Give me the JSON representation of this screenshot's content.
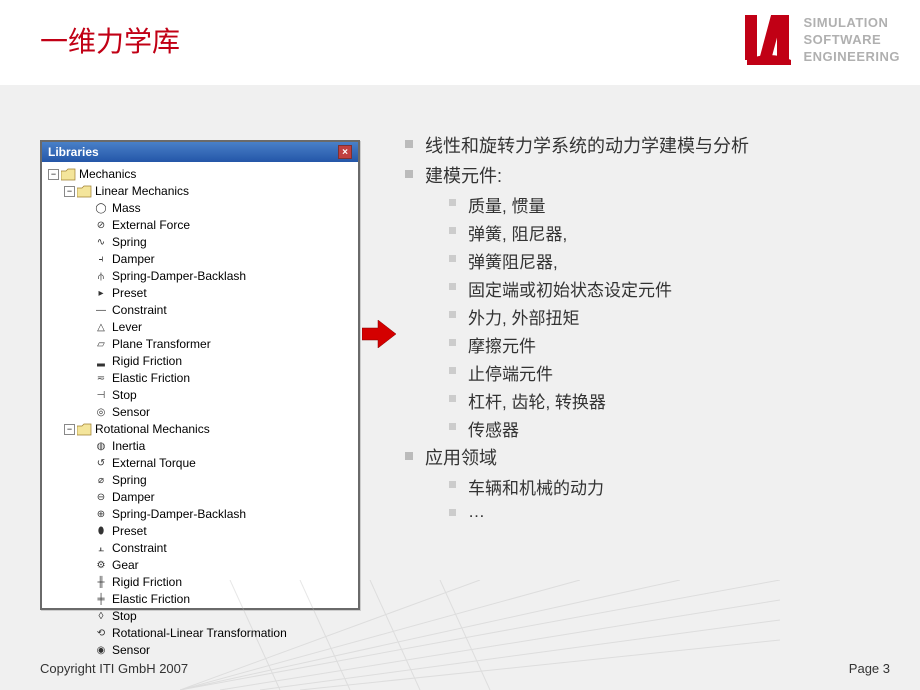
{
  "header": {
    "title": "一维力学库",
    "tagline": [
      "SIMULATION",
      "SOFTWARE",
      "ENGINEERING"
    ]
  },
  "tree": {
    "title": "Libraries",
    "root": {
      "label": "Mechanics",
      "type": "folder",
      "open": true,
      "children": [
        {
          "label": "Linear Mechanics",
          "type": "folder",
          "open": true,
          "children": [
            {
              "label": "Mass",
              "icon": "mass"
            },
            {
              "label": "External Force",
              "icon": "ext-force"
            },
            {
              "label": "Spring",
              "icon": "spring"
            },
            {
              "label": "Damper",
              "icon": "damper"
            },
            {
              "label": "Spring-Damper-Backlash",
              "icon": "sdb"
            },
            {
              "label": "Preset",
              "icon": "preset"
            },
            {
              "label": "Constraint",
              "icon": "constraint"
            },
            {
              "label": "Lever",
              "icon": "lever"
            },
            {
              "label": "Plane Transformer",
              "icon": "plane-trans"
            },
            {
              "label": "Rigid Friction",
              "icon": "rigid-friction"
            },
            {
              "label": "Elastic Friction",
              "icon": "elastic-friction"
            },
            {
              "label": "Stop",
              "icon": "stop"
            },
            {
              "label": "Sensor",
              "icon": "sensor"
            }
          ]
        },
        {
          "label": "Rotational Mechanics",
          "type": "folder",
          "open": true,
          "children": [
            {
              "label": "Inertia",
              "icon": "inertia"
            },
            {
              "label": "External Torque",
              "icon": "ext-torque"
            },
            {
              "label": "Spring",
              "icon": "rot-spring"
            },
            {
              "label": "Damper",
              "icon": "rot-damper"
            },
            {
              "label": "Spring-Damper-Backlash",
              "icon": "rot-sdb"
            },
            {
              "label": "Preset",
              "icon": "rot-preset"
            },
            {
              "label": "Constraint",
              "icon": "rot-constraint"
            },
            {
              "label": "Gear",
              "icon": "gear"
            },
            {
              "label": "Rigid Friction",
              "icon": "rot-rigid-friction"
            },
            {
              "label": "Elastic Friction",
              "icon": "rot-elastic-friction"
            },
            {
              "label": "Stop",
              "icon": "rot-stop"
            },
            {
              "label": "Rotational-Linear Transformation",
              "icon": "rot-lin"
            },
            {
              "label": "Sensor",
              "icon": "rot-sensor"
            }
          ]
        }
      ]
    }
  },
  "content": {
    "level1": [
      {
        "text": "线性和旋转力学系统的动力学建模与分析"
      },
      {
        "text": "建模元件:",
        "children": [
          "质量, 惯量",
          "弹簧, 阻尼器,",
          "弹簧阻尼器,",
          "固定端或初始状态设定元件",
          "外力, 外部扭矩",
          "摩擦元件",
          "止停端元件",
          "杠杆, 齿轮, 转换器",
          "传感器"
        ]
      },
      {
        "text": "应用领域",
        "children": [
          "车辆和机械的动力",
          "…"
        ]
      }
    ]
  },
  "footer": {
    "copyright": "Copyright ITI GmbH  2007",
    "page": "Page 3"
  },
  "icon_glyphs": {
    "mass": "◯",
    "ext-force": "⊘",
    "spring": "∿",
    "damper": "⫞",
    "sdb": "⫛",
    "preset": "▸",
    "constraint": "—",
    "lever": "△",
    "plane-trans": "▱",
    "rigid-friction": "▂",
    "elastic-friction": "≂",
    "stop": "⊣",
    "sensor": "◎",
    "inertia": "◍",
    "ext-torque": "↺",
    "rot-spring": "⌀",
    "rot-damper": "⊖",
    "rot-sdb": "⊕",
    "rot-preset": "⬮",
    "rot-constraint": "⫠",
    "gear": "⚙",
    "rot-rigid-friction": "╫",
    "rot-elastic-friction": "╪",
    "rot-stop": "◊",
    "rot-lin": "⟲",
    "rot-sensor": "◉"
  }
}
